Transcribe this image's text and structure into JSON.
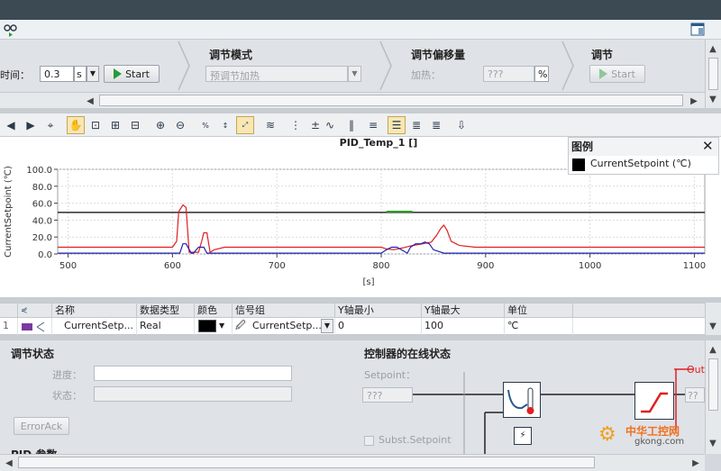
{
  "header": {
    "title_icon": "glasses-icon",
    "panel_icon": "panel-toggle-icon"
  },
  "tuning": {
    "sample_label": "时间：",
    "sample_value": "0.3",
    "sample_unit": "s",
    "start_label": "Start",
    "mode_title": "调节模式",
    "mode_value": "预调节加热",
    "offset_title": "调节偏移量",
    "offset_label": "加热：",
    "offset_value": "???",
    "offset_unit": "%",
    "tune_title": "调节",
    "tune_start_label": "Start"
  },
  "chart_title": "PID_Temp_1 []",
  "legend": {
    "title": "图例",
    "item": "CurrentSetpoint (℃)",
    "item_color": "#000000"
  },
  "chart_data": {
    "type": "line",
    "title": "PID_Temp_1 []",
    "xlabel": "[s]",
    "ylabel": "CurrentSetpoint (℃)",
    "xlim": [
      490,
      1110
    ],
    "ylim": [
      0,
      100
    ],
    "xticks": [
      500,
      600,
      700,
      800,
      900,
      1000,
      1100
    ],
    "yticks": [
      "100.0",
      "80.0",
      "60.0",
      "40.0",
      "20.0",
      "0.0"
    ],
    "grid": true,
    "series": [
      {
        "name": "CurrentSetpoint (℃)",
        "color": "#000000",
        "x": [
          490,
          1110
        ],
        "y": [
          49,
          49
        ]
      },
      {
        "color": "#e02020",
        "x": [
          490,
          600,
          604,
          606,
          610,
          613,
          616,
          625,
          628,
          630,
          633,
          636,
          640,
          650,
          700,
          800,
          805,
          812,
          820,
          830,
          840,
          848,
          853,
          857,
          860,
          863,
          867,
          875,
          890,
          1000,
          1110
        ],
        "y": [
          8,
          8,
          15,
          50,
          58,
          55,
          2,
          2,
          15,
          25,
          25,
          2,
          5,
          8,
          8,
          8,
          6,
          5,
          7,
          10,
          12,
          14,
          22,
          30,
          34,
          28,
          15,
          10,
          8,
          8,
          8
        ]
      },
      {
        "color": "#2020b0",
        "x": [
          490,
          607,
          610,
          613,
          618,
          620,
          625,
          630,
          633,
          640,
          650,
          800,
          805,
          810,
          815,
          825,
          828,
          833,
          838,
          842,
          846,
          850,
          860,
          870,
          1110
        ],
        "y": [
          1,
          1,
          12,
          12,
          1,
          1,
          8,
          8,
          1,
          1,
          1,
          1,
          5,
          8,
          8,
          1,
          8,
          12,
          12,
          14,
          12,
          5,
          1,
          1,
          1
        ]
      },
      {
        "color": "#20a020",
        "x": [
          805,
          815,
          820,
          830
        ],
        "y": [
          50,
          50,
          50,
          50
        ]
      }
    ]
  },
  "grid": {
    "headers": [
      "名称",
      "数据类型",
      "颜色",
      "信号组",
      "Y轴最小",
      "Y轴最大",
      "单位"
    ],
    "row": {
      "index": "1",
      "name": "CurrentSetp...",
      "type": "Real",
      "color": "#000000",
      "signal_group": "CurrentSetp...",
      "ymin": "0",
      "ymax": "100",
      "unit": "℃"
    }
  },
  "tuning_status": {
    "title": "调节状态",
    "progress_label": "进度：",
    "status_label": "状态：",
    "errorack_label": "ErrorAck",
    "pid_params_label": "PID 参数"
  },
  "controller": {
    "title": "控制器的在线状态",
    "setpoint_label": "Setpoint：",
    "setpoint_value": "???",
    "subst_label": "Subst.Setpoint",
    "out_label": "Out",
    "out_value": "??"
  },
  "watermark": {
    "text": "中华工控网",
    "sub": "gkong.com"
  }
}
